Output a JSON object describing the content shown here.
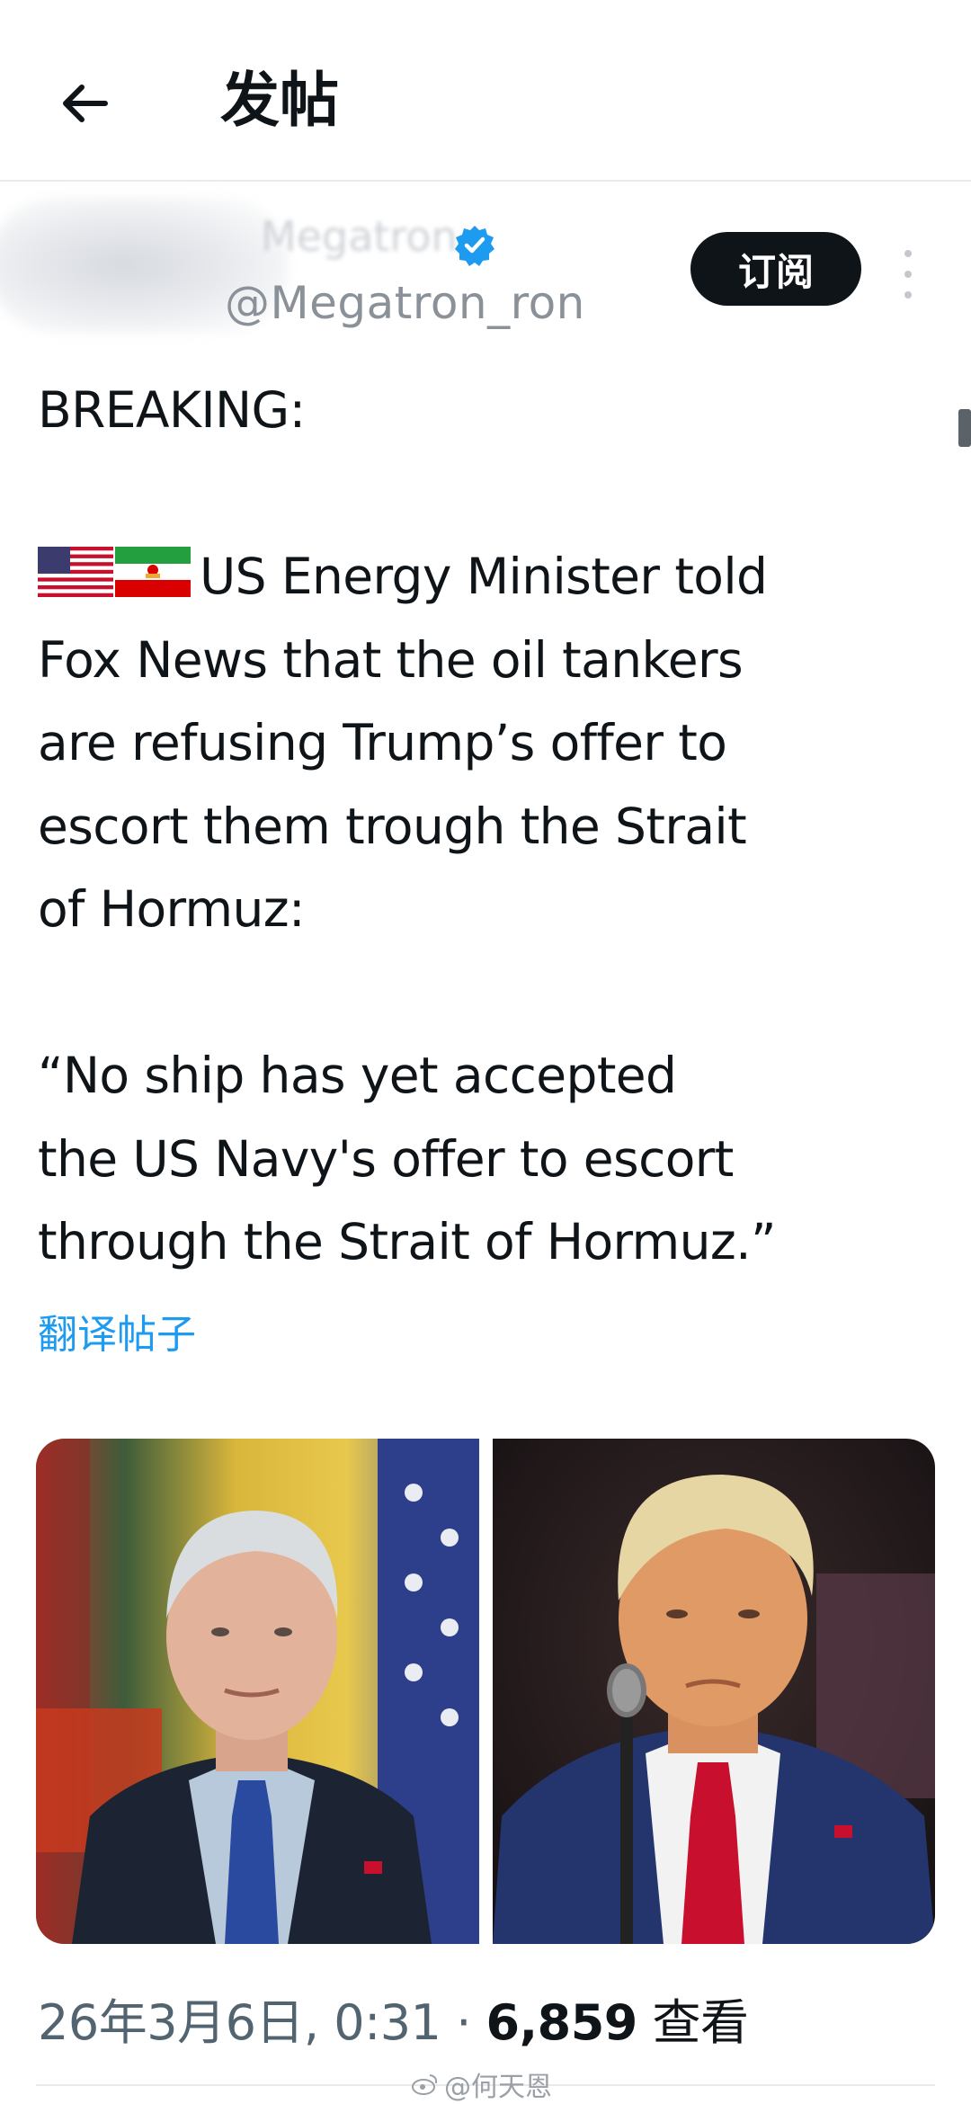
{
  "header": {
    "title": "发帖"
  },
  "author": {
    "display_name": "Megatron",
    "handle": "@Megatron_ron",
    "subscribe_label": "订阅"
  },
  "tweet": {
    "lines": [
      "BREAKING:",
      "US Energy Minister told",
      "Fox News that the oil tankers",
      "are refusing Trump’s offer to",
      "escort them trough the Strait",
      "of Hormuz:",
      "“No ship has yet accepted",
      "the US Navy's offer to escort",
      "through the Strait of Hormuz.”"
    ],
    "translate_label": "翻译帖子"
  },
  "meta": {
    "timestamp": "26年3月6日, 0:31",
    "separator": "·",
    "views_count": "6,859",
    "views_label": "查看"
  },
  "watermark": "@何天恩",
  "colors": {
    "link": "#1d9bf0",
    "verified": "#1d9bf0",
    "text": "#0f1419",
    "muted": "#536471",
    "button_bg": "#0f1419"
  },
  "icons": {
    "back": "arrow-left-icon",
    "verified": "verified-badge-icon",
    "more": "more-vertical-icon",
    "flag_us": "us-flag-icon",
    "flag_iran": "iran-flag-icon"
  }
}
